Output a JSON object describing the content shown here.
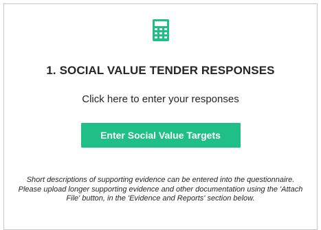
{
  "colors": {
    "accent": "#1fbf87",
    "text": "#262626",
    "border": "#c8c8c8"
  },
  "icon": "calculator-icon",
  "section": {
    "title": "1. SOCIAL VALUE TENDER RESPONSES",
    "subtitle": "Click here to enter your responses",
    "button_label": "Enter Social Value Targets",
    "note": "Short descriptions of supporting evidence can be entered into the questionnaire. Please upload longer supporting evidence and other documentation using the 'Attach File' button, in the 'Evidence and Reports' section below."
  }
}
